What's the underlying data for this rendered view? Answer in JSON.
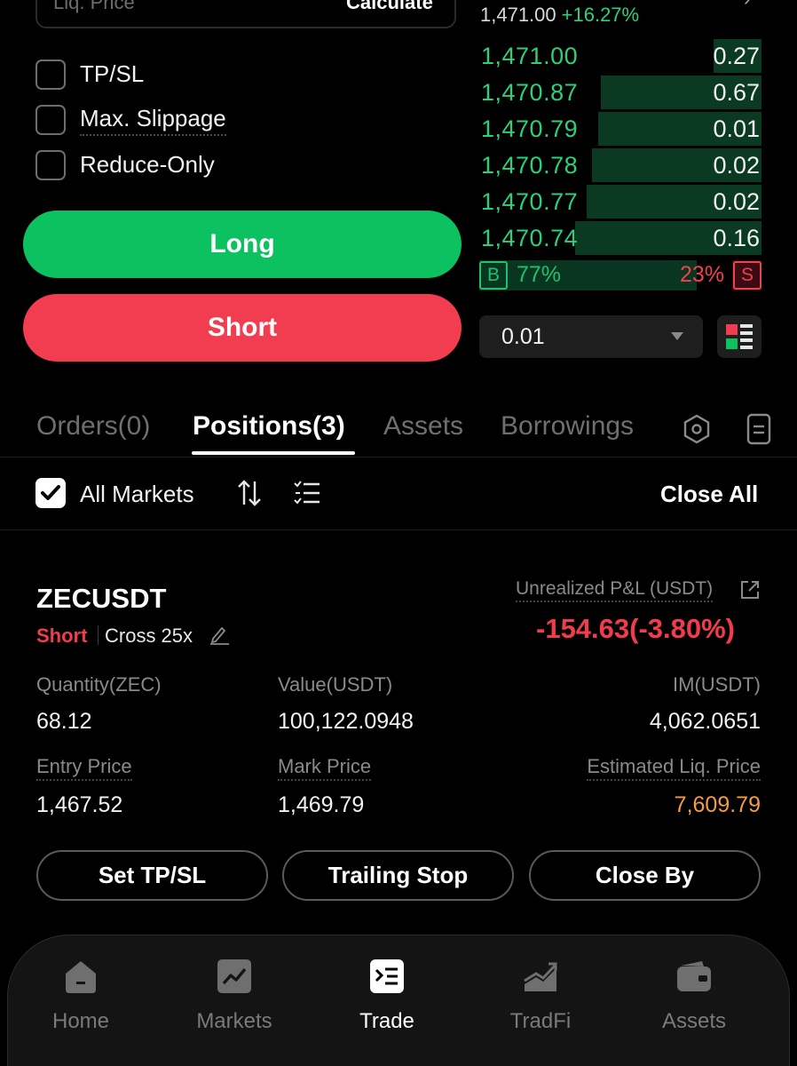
{
  "order_form": {
    "liq_price_placeholder": "Liq. Price",
    "calculate_label": "Calculate",
    "options": [
      {
        "label": "TP/SL",
        "checked": false
      },
      {
        "label": "Max. Slippage",
        "checked": false
      },
      {
        "label": "Reduce-Only",
        "checked": false
      }
    ],
    "long_label": "Long",
    "short_label": "Short"
  },
  "order_book": {
    "last_price": "1,471.00",
    "change": "+16.27%",
    "rows": [
      {
        "price": "1,471.00",
        "qty": "0.27",
        "depth": 0.17
      },
      {
        "price": "1,470.87",
        "qty": "0.67",
        "depth": 0.57
      },
      {
        "price": "1,470.79",
        "qty": "0.01",
        "depth": 0.58
      },
      {
        "price": "1,470.78",
        "qty": "0.02",
        "depth": 0.6
      },
      {
        "price": "1,470.77",
        "qty": "0.02",
        "depth": 0.62
      },
      {
        "price": "1,470.74",
        "qty": "0.16",
        "depth": 0.66
      }
    ],
    "buy_label": "B",
    "buy_pct": "77%",
    "buy_ratio": 0.77,
    "sell_label": "S",
    "sell_pct": "23%",
    "precision": "0.01"
  },
  "tabs": [
    {
      "label": "Orders(0)",
      "active": false
    },
    {
      "label": "Positions(3)",
      "active": true
    },
    {
      "label": "Assets",
      "active": false
    },
    {
      "label": "Borrowings",
      "active": false
    }
  ],
  "filters": {
    "all_markets_label": "All Markets",
    "all_markets_checked": true,
    "close_all_label": "Close All"
  },
  "position": {
    "symbol": "ZECUSDT",
    "side": "Short",
    "margin_mode": "Cross 25x",
    "pnl_label": "Unrealized P&L (USDT)",
    "pnl_value": "-154.63(-3.80%)",
    "fields": {
      "quantity": {
        "label": "Quantity(ZEC)",
        "value": "68.12"
      },
      "value": {
        "label": "Value(USDT)",
        "value": "100,122.0948"
      },
      "im": {
        "label": "IM(USDT)",
        "value": "4,062.0651"
      },
      "entry_price": {
        "label": "Entry Price",
        "value": "1,467.52"
      },
      "mark_price": {
        "label": "Mark Price",
        "value": "1,469.79"
      },
      "liq_price": {
        "label": "Estimated Liq. Price",
        "value": "7,609.79"
      }
    },
    "buttons": {
      "tpsl": "Set TP/SL",
      "trailing": "Trailing Stop",
      "close_by": "Close By"
    }
  },
  "nav": {
    "items": [
      {
        "label": "Home",
        "icon": "home-icon",
        "active": false
      },
      {
        "label": "Markets",
        "icon": "markets-chart-icon",
        "active": false
      },
      {
        "label": "Trade",
        "icon": "trade-icon",
        "active": true
      },
      {
        "label": "TradFi",
        "icon": "tradfi-icon",
        "active": false
      },
      {
        "label": "Assets",
        "icon": "wallet-icon",
        "active": false
      }
    ]
  },
  "colors": {
    "buy_green": "#0bc160",
    "sell_red": "#f13d4f",
    "liq_orange": "#f59a46",
    "background": "#000000"
  }
}
